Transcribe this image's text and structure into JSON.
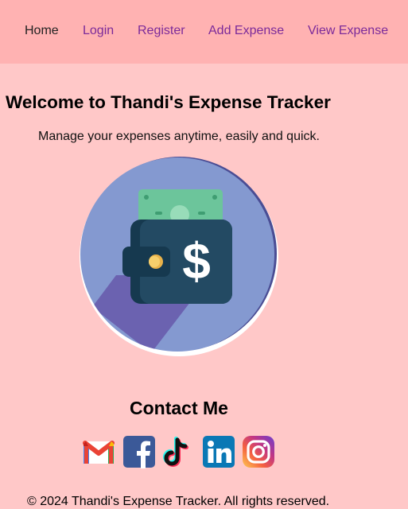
{
  "nav": {
    "home": "Home",
    "login": "Login",
    "register": "Register",
    "add_expense": "Add Expense",
    "view_expense": "View Expense"
  },
  "hero": {
    "title": "Welcome to Thandi's Expense Tracker",
    "subtitle": "Manage your expenses anytime, easily and quick.",
    "image_icon": "wallet-dollar-icon"
  },
  "contact": {
    "title": "Contact Me",
    "icons": [
      "gmail-icon",
      "facebook-icon",
      "tiktok-icon",
      "linkedin-icon",
      "instagram-icon"
    ]
  },
  "footer": {
    "text": "© 2024 Thandi's Expense Tracker. All rights reserved."
  },
  "colors": {
    "page_background": "#ffc8c8",
    "navbar_background": "#ffb2b2",
    "link": "#7b2a9a",
    "active_link": "#222222"
  }
}
